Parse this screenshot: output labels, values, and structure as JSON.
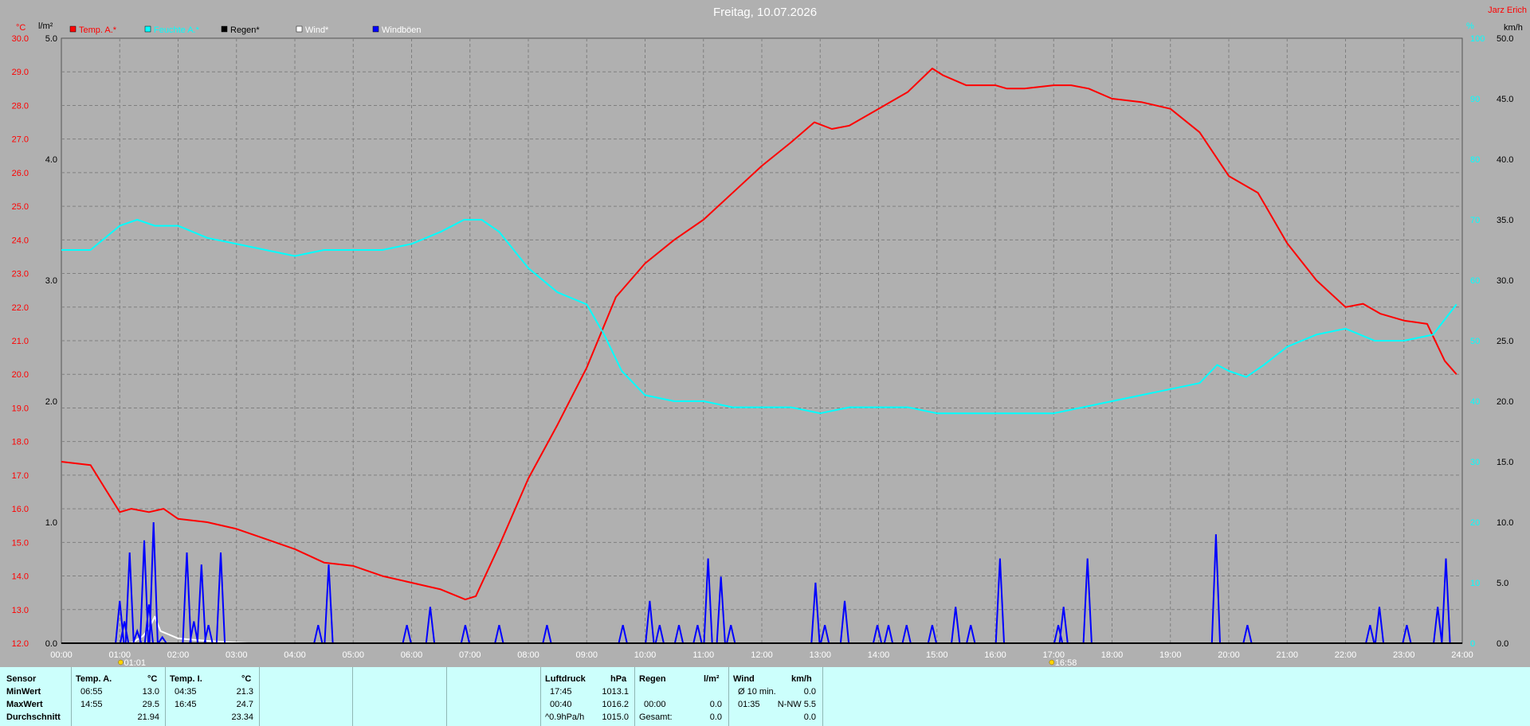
{
  "header": {
    "title": "Freitag, 10.07.2026",
    "station": "Jarz Erich",
    "left_units": [
      "°C",
      "l/m²"
    ],
    "right_units": [
      "%",
      "km/h"
    ]
  },
  "legend": [
    {
      "label": "Temp. A.*",
      "color": "#ff0000",
      "text_color": "#ff0000"
    },
    {
      "label": "Feuchte A.*",
      "color": "#00ffff",
      "text_color": "#00ffff"
    },
    {
      "label": "Regen*",
      "color": "#000000",
      "text_color": "#000000"
    },
    {
      "label": "Wind*",
      "color": "#ffffff",
      "text_color": "#ffffff"
    },
    {
      "label": "Windböen",
      "color": "#0000ff",
      "text_color": "#ffffff"
    }
  ],
  "markers": {
    "sunrise": "01:01",
    "sunset": "16:58"
  },
  "chart_data": {
    "type": "line",
    "x_unit": "hours",
    "xlim": [
      0,
      24
    ],
    "x_ticks": [
      "00:00",
      "01:00",
      "02:00",
      "03:00",
      "04:00",
      "05:00",
      "06:00",
      "07:00",
      "08:00",
      "09:00",
      "10:00",
      "11:00",
      "12:00",
      "13:00",
      "14:00",
      "15:00",
      "16:00",
      "17:00",
      "18:00",
      "19:00",
      "20:00",
      "21:00",
      "22:00",
      "23:00",
      "24:00"
    ],
    "axes": {
      "temp": {
        "label": "°C",
        "ylim": [
          12,
          30
        ],
        "ticks": [
          "12.0",
          "13.0",
          "14.0",
          "15.0",
          "16.0",
          "17.0",
          "18.0",
          "19.0",
          "20.0",
          "21.0",
          "22.0",
          "23.0",
          "24.0",
          "25.0",
          "26.0",
          "27.0",
          "28.0",
          "29.0",
          "30.0"
        ]
      },
      "rain": {
        "label": "l/m²",
        "ylim": [
          0,
          5
        ],
        "ticks": [
          "0.0",
          "1.0",
          "2.0",
          "3.0",
          "4.0",
          "5.0"
        ]
      },
      "humidity": {
        "label": "%",
        "ylim": [
          0,
          100
        ],
        "ticks": [
          "0",
          "10",
          "20",
          "30",
          "40",
          "50",
          "60",
          "70",
          "80",
          "90",
          "100"
        ]
      },
      "wind": {
        "label": "km/h",
        "ylim": [
          0,
          50
        ],
        "ticks": [
          "0.0",
          "5.0",
          "10.0",
          "15.0",
          "20.0",
          "25.0",
          "30.0",
          "35.0",
          "40.0",
          "45.0",
          "50.0"
        ]
      }
    },
    "grid": true,
    "series": [
      {
        "name": "Temp. A.*",
        "axis": "temp",
        "color": "#ff0000",
        "x": [
          0,
          0.5,
          0.75,
          1,
          1.2,
          1.5,
          1.75,
          2,
          2.5,
          3,
          3.5,
          4,
          4.5,
          5,
          5.5,
          6,
          6.5,
          6.92,
          7.1,
          7.5,
          8,
          8.5,
          9,
          9.5,
          10,
          10.5,
          11,
          11.5,
          12,
          12.5,
          12.9,
          13.2,
          13.5,
          14,
          14.5,
          14.92,
          15.1,
          15.5,
          16,
          16.2,
          16.5,
          17,
          17.3,
          17.6,
          18,
          18.5,
          19,
          19.5,
          20,
          20.5,
          21,
          21.5,
          22,
          22.3,
          22.6,
          23,
          23.4,
          23.7,
          23.9
        ],
        "y": [
          17.4,
          17.3,
          16.6,
          15.9,
          16.0,
          15.9,
          16.0,
          15.7,
          15.6,
          15.4,
          15.1,
          14.8,
          14.4,
          14.3,
          14.0,
          13.8,
          13.6,
          13.3,
          13.4,
          14.9,
          16.9,
          18.5,
          20.2,
          22.3,
          23.3,
          24.0,
          24.6,
          25.4,
          26.2,
          26.9,
          27.5,
          27.3,
          27.4,
          27.9,
          28.4,
          29.1,
          28.9,
          28.6,
          28.6,
          28.5,
          28.5,
          28.6,
          28.6,
          28.5,
          28.2,
          28.1,
          27.9,
          27.2,
          25.9,
          25.4,
          23.9,
          22.8,
          22.0,
          22.1,
          21.8,
          21.6,
          21.5,
          20.4,
          20.0
        ]
      },
      {
        "name": "Feuchte A.*",
        "axis": "humidity",
        "color": "#00ffff",
        "x": [
          0,
          0.5,
          1,
          1.3,
          1.6,
          2,
          2.5,
          3,
          3.5,
          4,
          4.5,
          5,
          5.5,
          6,
          6.5,
          6.9,
          7.2,
          7.5,
          8,
          8.5,
          9,
          9.3,
          9.6,
          10,
          10.5,
          11,
          11.5,
          12,
          12.5,
          13,
          13.5,
          14,
          14.5,
          15,
          15.5,
          16,
          16.5,
          17,
          17.5,
          18,
          18.5,
          19,
          19.5,
          19.8,
          20,
          20.3,
          20.6,
          21,
          21.5,
          22,
          22.5,
          23,
          23.5,
          23.9
        ],
        "y": [
          65,
          65,
          69,
          70,
          69,
          69,
          67,
          66,
          65,
          64,
          65,
          65,
          65,
          66,
          68,
          70,
          70,
          68,
          62,
          58,
          56,
          51,
          45,
          41,
          40,
          40,
          39,
          39,
          39,
          38,
          39,
          39,
          39,
          38,
          38,
          38,
          38,
          38,
          39,
          40,
          41,
          42,
          43,
          46,
          45,
          44,
          46,
          49,
          51,
          52,
          50,
          50,
          51,
          56
        ]
      },
      {
        "name": "Wind*",
        "axis": "wind",
        "color": "#ffffff",
        "x": [
          0,
          1.2,
          1.4,
          1.5,
          1.6,
          1.7,
          1.8,
          2,
          2.2,
          2.5,
          2.8,
          3.2,
          24
        ],
        "y": [
          0,
          0,
          0.6,
          1.2,
          2.2,
          1.0,
          0.8,
          0.4,
          0.3,
          0.2,
          0.1,
          0,
          0
        ]
      },
      {
        "name": "Windböen",
        "axis": "wind",
        "color": "#0000ff",
        "gusts": [
          [
            1,
            3.5
          ],
          [
            1.08,
            1.8
          ],
          [
            1.17,
            7.5
          ],
          [
            1.3,
            1.0
          ],
          [
            1.42,
            8.5
          ],
          [
            1.5,
            3.2
          ],
          [
            1.58,
            10.0
          ],
          [
            1.73,
            0.5
          ],
          [
            2.15,
            7.5
          ],
          [
            2.27,
            1.8
          ],
          [
            2.4,
            6.5
          ],
          [
            2.52,
            1.5
          ],
          [
            2.73,
            7.5
          ],
          [
            4.4,
            1.5
          ],
          [
            4.58,
            6.5
          ],
          [
            5.92,
            1.5
          ],
          [
            6.32,
            3.0
          ],
          [
            6.92,
            1.5
          ],
          [
            7.5,
            1.5
          ],
          [
            8.32,
            1.5
          ],
          [
            9.62,
            1.5
          ],
          [
            10.08,
            3.5
          ],
          [
            10.25,
            1.5
          ],
          [
            10.58,
            1.5
          ],
          [
            10.9,
            1.5
          ],
          [
            11.08,
            7.0
          ],
          [
            11.3,
            5.5
          ],
          [
            11.47,
            1.5
          ],
          [
            12.92,
            5.0
          ],
          [
            13.08,
            1.5
          ],
          [
            13.42,
            3.5
          ],
          [
            13.98,
            1.5
          ],
          [
            14.17,
            1.5
          ],
          [
            14.48,
            1.5
          ],
          [
            14.92,
            1.5
          ],
          [
            15.32,
            3.0
          ],
          [
            15.58,
            1.5
          ],
          [
            16.08,
            7.0
          ],
          [
            17.08,
            1.5
          ],
          [
            17.17,
            3.0
          ],
          [
            17.58,
            7.0
          ],
          [
            19.78,
            9.0
          ],
          [
            20.32,
            1.5
          ],
          [
            22.42,
            1.5
          ],
          [
            22.58,
            3.0
          ],
          [
            23.05,
            1.5
          ],
          [
            23.58,
            3.0
          ],
          [
            23.72,
            7.0
          ]
        ]
      },
      {
        "name": "Regen*",
        "axis": "rain",
        "color": "#000000",
        "x": [
          0,
          24
        ],
        "y": [
          0,
          0
        ]
      }
    ]
  },
  "stats": {
    "sensor_label": "Sensor",
    "min_label": "MinWert",
    "max_label": "MaxWert",
    "avg_label": "Durchschnitt",
    "temp_a": {
      "title": "Temp. A.",
      "unit": "°C",
      "min_time": "06:55",
      "min_val": "13.0",
      "max_time": "14:55",
      "max_val": "29.5",
      "avg": "21.94"
    },
    "temp_i": {
      "title": "Temp. I.",
      "unit": "°C",
      "min_time": "04:35",
      "min_val": "21.3",
      "max_time": "16:45",
      "max_val": "24.7",
      "avg": "23.34"
    },
    "pressure": {
      "title": "Luftdruck",
      "unit": "hPa",
      "min_time": "17:45",
      "min_val": "1013.1",
      "max_time": "00:40",
      "max_val": "1016.2",
      "trend_label": "^0.9hPa/h",
      "trend_val": "1015.0"
    },
    "rain": {
      "title": "Regen",
      "unit": "l/m²",
      "time": "00:00",
      "val": "0.0",
      "total_label": "Gesamt:",
      "total_val": "0.0"
    },
    "wind": {
      "title": "Wind",
      "unit": "km/h",
      "avg_label": "Ø 10 min.",
      "avg_val": "0.0",
      "max_time": "01:35",
      "max_val": "N-NW 5.5",
      "third_val": "0.0"
    }
  }
}
